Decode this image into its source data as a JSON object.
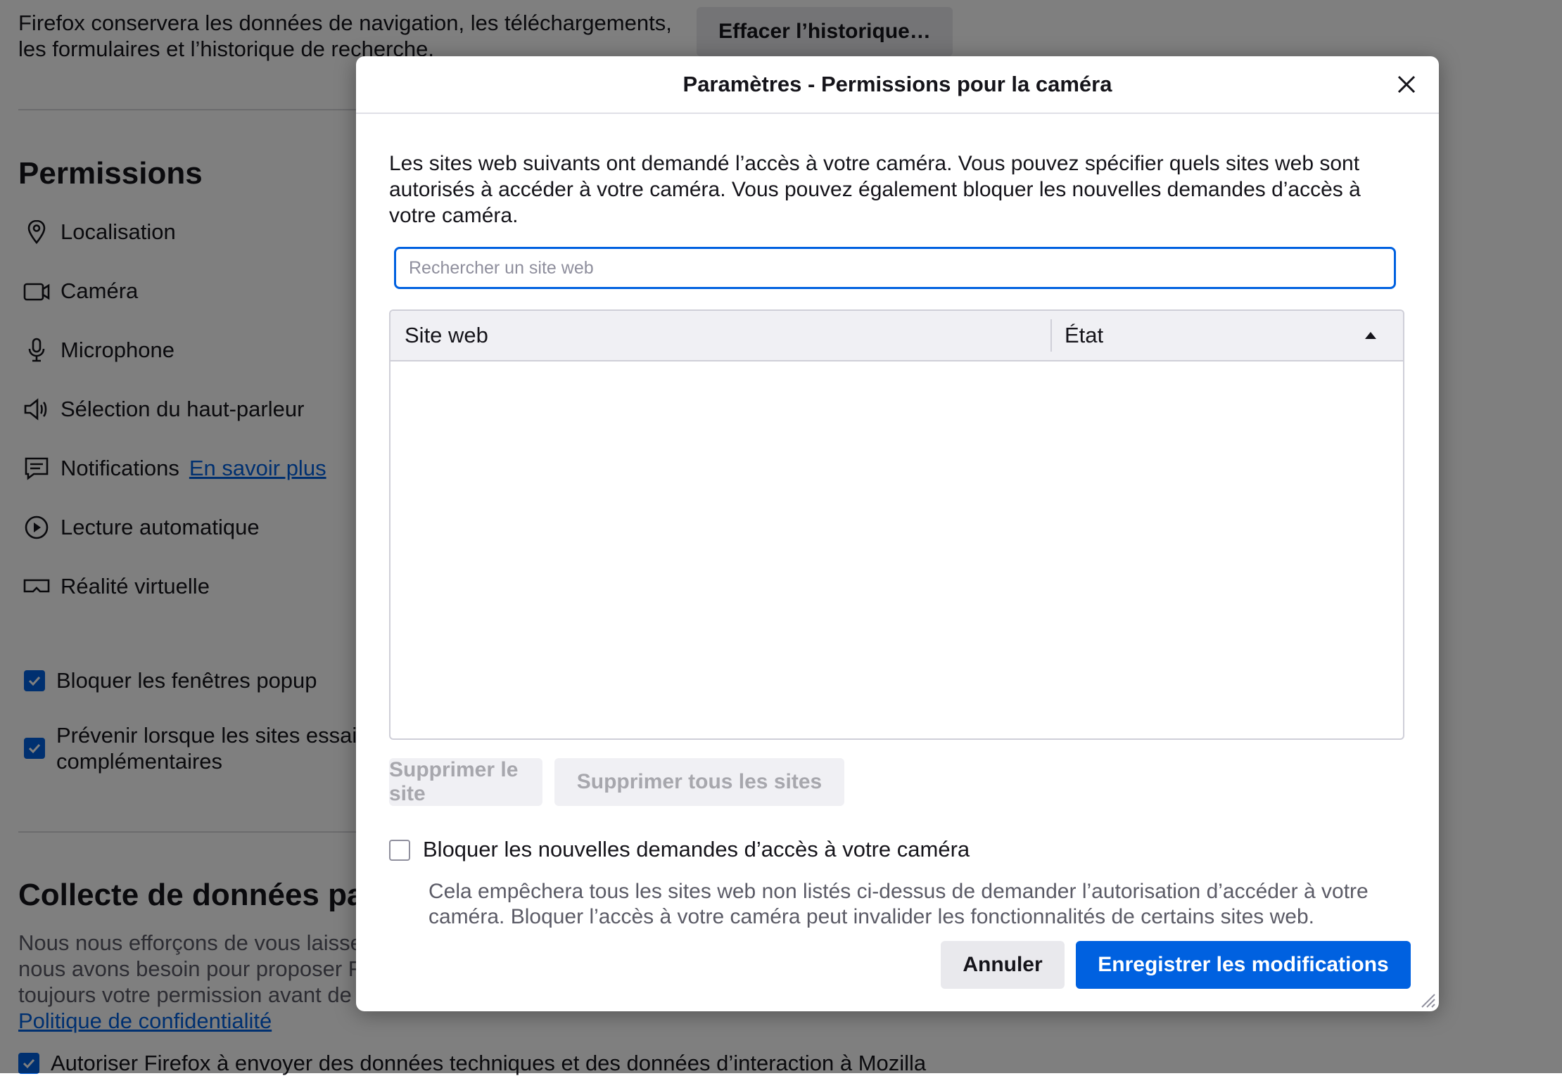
{
  "background": {
    "history_text": "Firefox conservera les données de navigation, les téléchargements, les formulaires et l’historique de recherche.",
    "history_line1": "Firefox conservera les données de navigation, les téléchargements,",
    "history_line2": "les formulaires et l’historique de recherche.",
    "clear_history_button": "Effacer l’historique…",
    "permissions_heading": "Permissions",
    "permissions": [
      {
        "label": "Localisation",
        "icon": "location-icon"
      },
      {
        "label": "Caméra",
        "icon": "camera-icon"
      },
      {
        "label": "Microphone",
        "icon": "microphone-icon"
      },
      {
        "label": "Sélection du haut-parleur",
        "icon": "speaker-icon"
      },
      {
        "label": "Notifications",
        "icon": "notification-icon"
      },
      {
        "label": "Lecture automatique",
        "icon": "autoplay-icon"
      },
      {
        "label": "Réalité virtuelle",
        "icon": "vr-icon"
      }
    ],
    "learn_more": "En savoir plus",
    "block_popups": "Bloquer les fenêtres popup",
    "warn_line1": "Prévenir lorsque les sites essai",
    "warn_line2": "complémentaires",
    "data_collection_heading": "Collecte de données par",
    "data_text_line1": "Nous nous efforçons de vous laisse",
    "data_text_line2": "nous avons besoin pour proposer F",
    "data_text_line3": "toujours votre permission avant de",
    "privacy_link": "Politique de confidentialité",
    "allow_telemetry": "Autoriser Firefox à envoyer des données techniques et des données d’interaction à Mozilla"
  },
  "dialog": {
    "title": "Paramètres - Permissions pour la caméra",
    "description": "Les sites web suivants ont demandé l’accès à votre caméra. Vous pouvez spécifier quels sites web sont autorisés à accéder à votre caméra. Vous pouvez également bloquer les nouvelles demandes d’accès à votre caméra.",
    "search_placeholder": "Rechercher un site web",
    "search_value": "",
    "columns": [
      "Site web",
      "État"
    ],
    "rows": [],
    "remove_site": "Supprimer le site",
    "remove_all_sites": "Supprimer tous les sites",
    "block_new_requests": "Bloquer les nouvelles demandes d’accès à votre caméra",
    "block_new_requests_checked": false,
    "block_help": "Cela empêchera tous les sites web non listés ci-dessus de demander l’autorisation d’accéder à votre caméra. Bloquer l’accès à votre caméra peut invalider les fonctionnalités de certains sites web.",
    "cancel": "Annuler",
    "save": "Enregistrer les modifications"
  },
  "colors": {
    "accent": "#0061e0",
    "overlay": "rgba(0,0,0,0.5)"
  }
}
